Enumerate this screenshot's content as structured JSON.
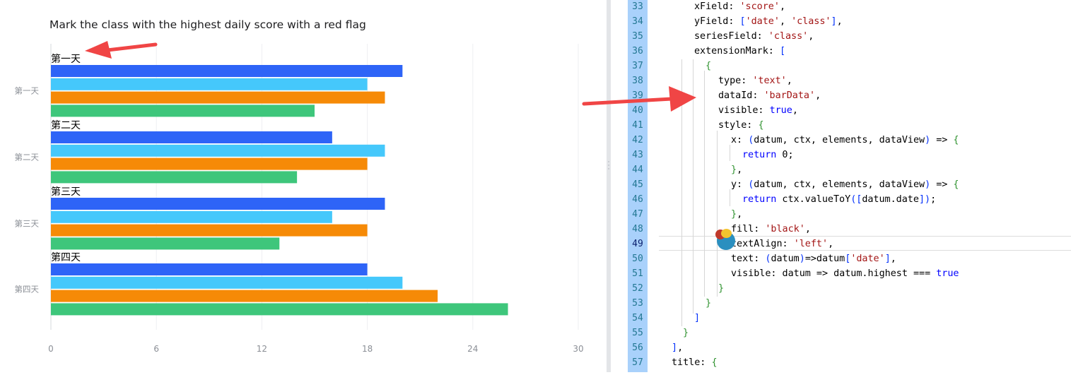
{
  "chart_panel": {
    "title": "Mark the class with the highest daily score with a red flag",
    "colors": {
      "series": [
        "#2e64f7",
        "#45c8fb",
        "#f68a07",
        "#3ec67b"
      ],
      "arrow": "#f04545"
    }
  },
  "chart_data": {
    "type": "bar",
    "orientation": "horizontal",
    "title": "Mark the class with the highest daily score with a red flag",
    "categories": [
      "第一天",
      "第二天",
      "第三天",
      "第四天"
    ],
    "series": [
      {
        "values": [
          20,
          16,
          19,
          18
        ]
      },
      {
        "values": [
          18,
          19,
          16,
          20
        ]
      },
      {
        "values": [
          19,
          18,
          18,
          22
        ]
      },
      {
        "values": [
          15,
          14,
          13,
          26
        ]
      }
    ],
    "group_labels": [
      "第一天",
      "第二天",
      "第三天",
      "第四天"
    ],
    "xlim": [
      0,
      30
    ],
    "xticks": [
      "0",
      "6",
      "12",
      "18",
      "24",
      "30"
    ],
    "grid": true
  },
  "editor": {
    "line_numbers": [
      "33",
      "34",
      "35",
      "36",
      "37",
      "38",
      "39",
      "40",
      "41",
      "42",
      "43",
      "44",
      "45",
      "46",
      "47",
      "48",
      "49",
      "50",
      "51",
      "52",
      "53",
      "54",
      "55",
      "56",
      "57"
    ],
    "active_line": "49",
    "lines": [
      "xField: 'score',",
      "yField: ['date', 'class'],",
      "seriesField: 'class',",
      "extensionMark: [",
      "{",
      "type: 'text',",
      "dataId: 'barData',",
      "visible: true,",
      "style: {",
      "x: (datum, ctx, elements, dataView) => {",
      "return 0;",
      "},",
      "y: (datum, ctx, elements, dataView) => {",
      "return ctx.valueToY([datum.date]);",
      "},",
      "fill: 'black',",
      "textAlign: 'left',",
      "text: (datum)=>datum['date'],",
      "visible: datum => datum.highest === true",
      "}",
      "}",
      "]",
      "}",
      "],",
      "title: {"
    ]
  }
}
